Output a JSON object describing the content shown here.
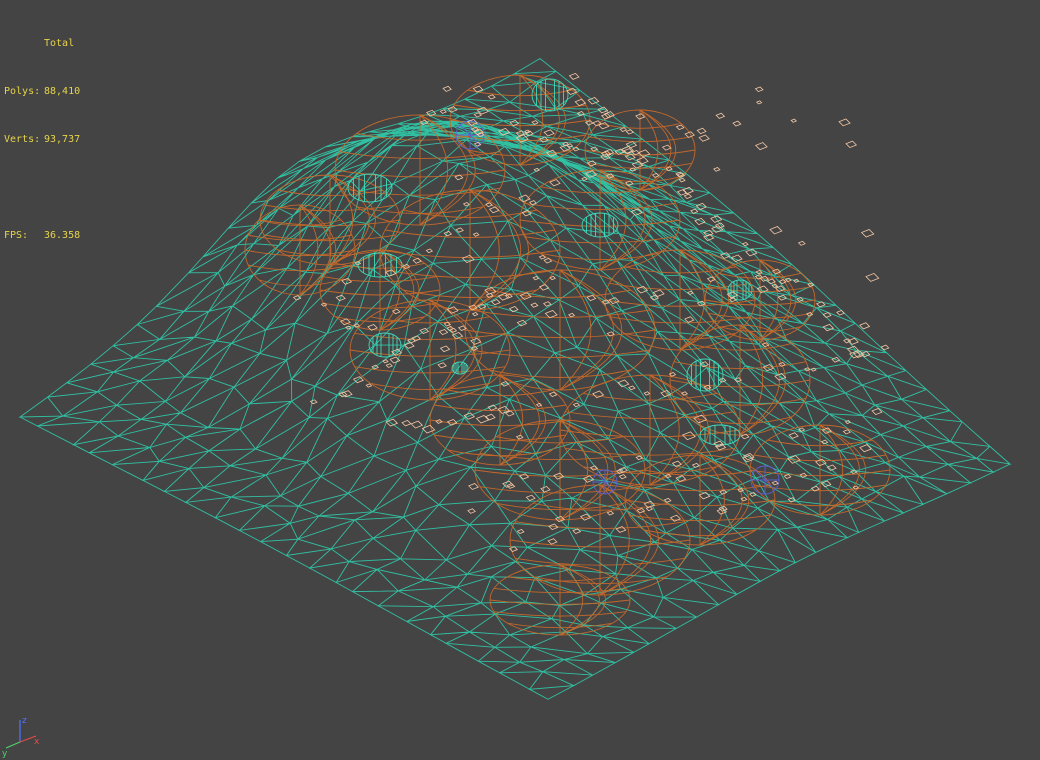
{
  "stats": {
    "total_label": "Total",
    "polys_label": "Polys:",
    "polys_value": "88,410",
    "verts_label": "Verts:",
    "verts_value": "93,737",
    "fps_label": "FPS:",
    "fps_value": "36.358"
  },
  "axis_gizmo": {
    "x": "x",
    "y": "y",
    "z": "z"
  },
  "colors": {
    "background": "#444444",
    "stats_text": "#e6d44a",
    "terrain_wire": "#2fc7a8",
    "rock_wire": "#c8692a",
    "debris_wire": "#f3c7a5",
    "accent_wire": "#5a5fd2"
  }
}
